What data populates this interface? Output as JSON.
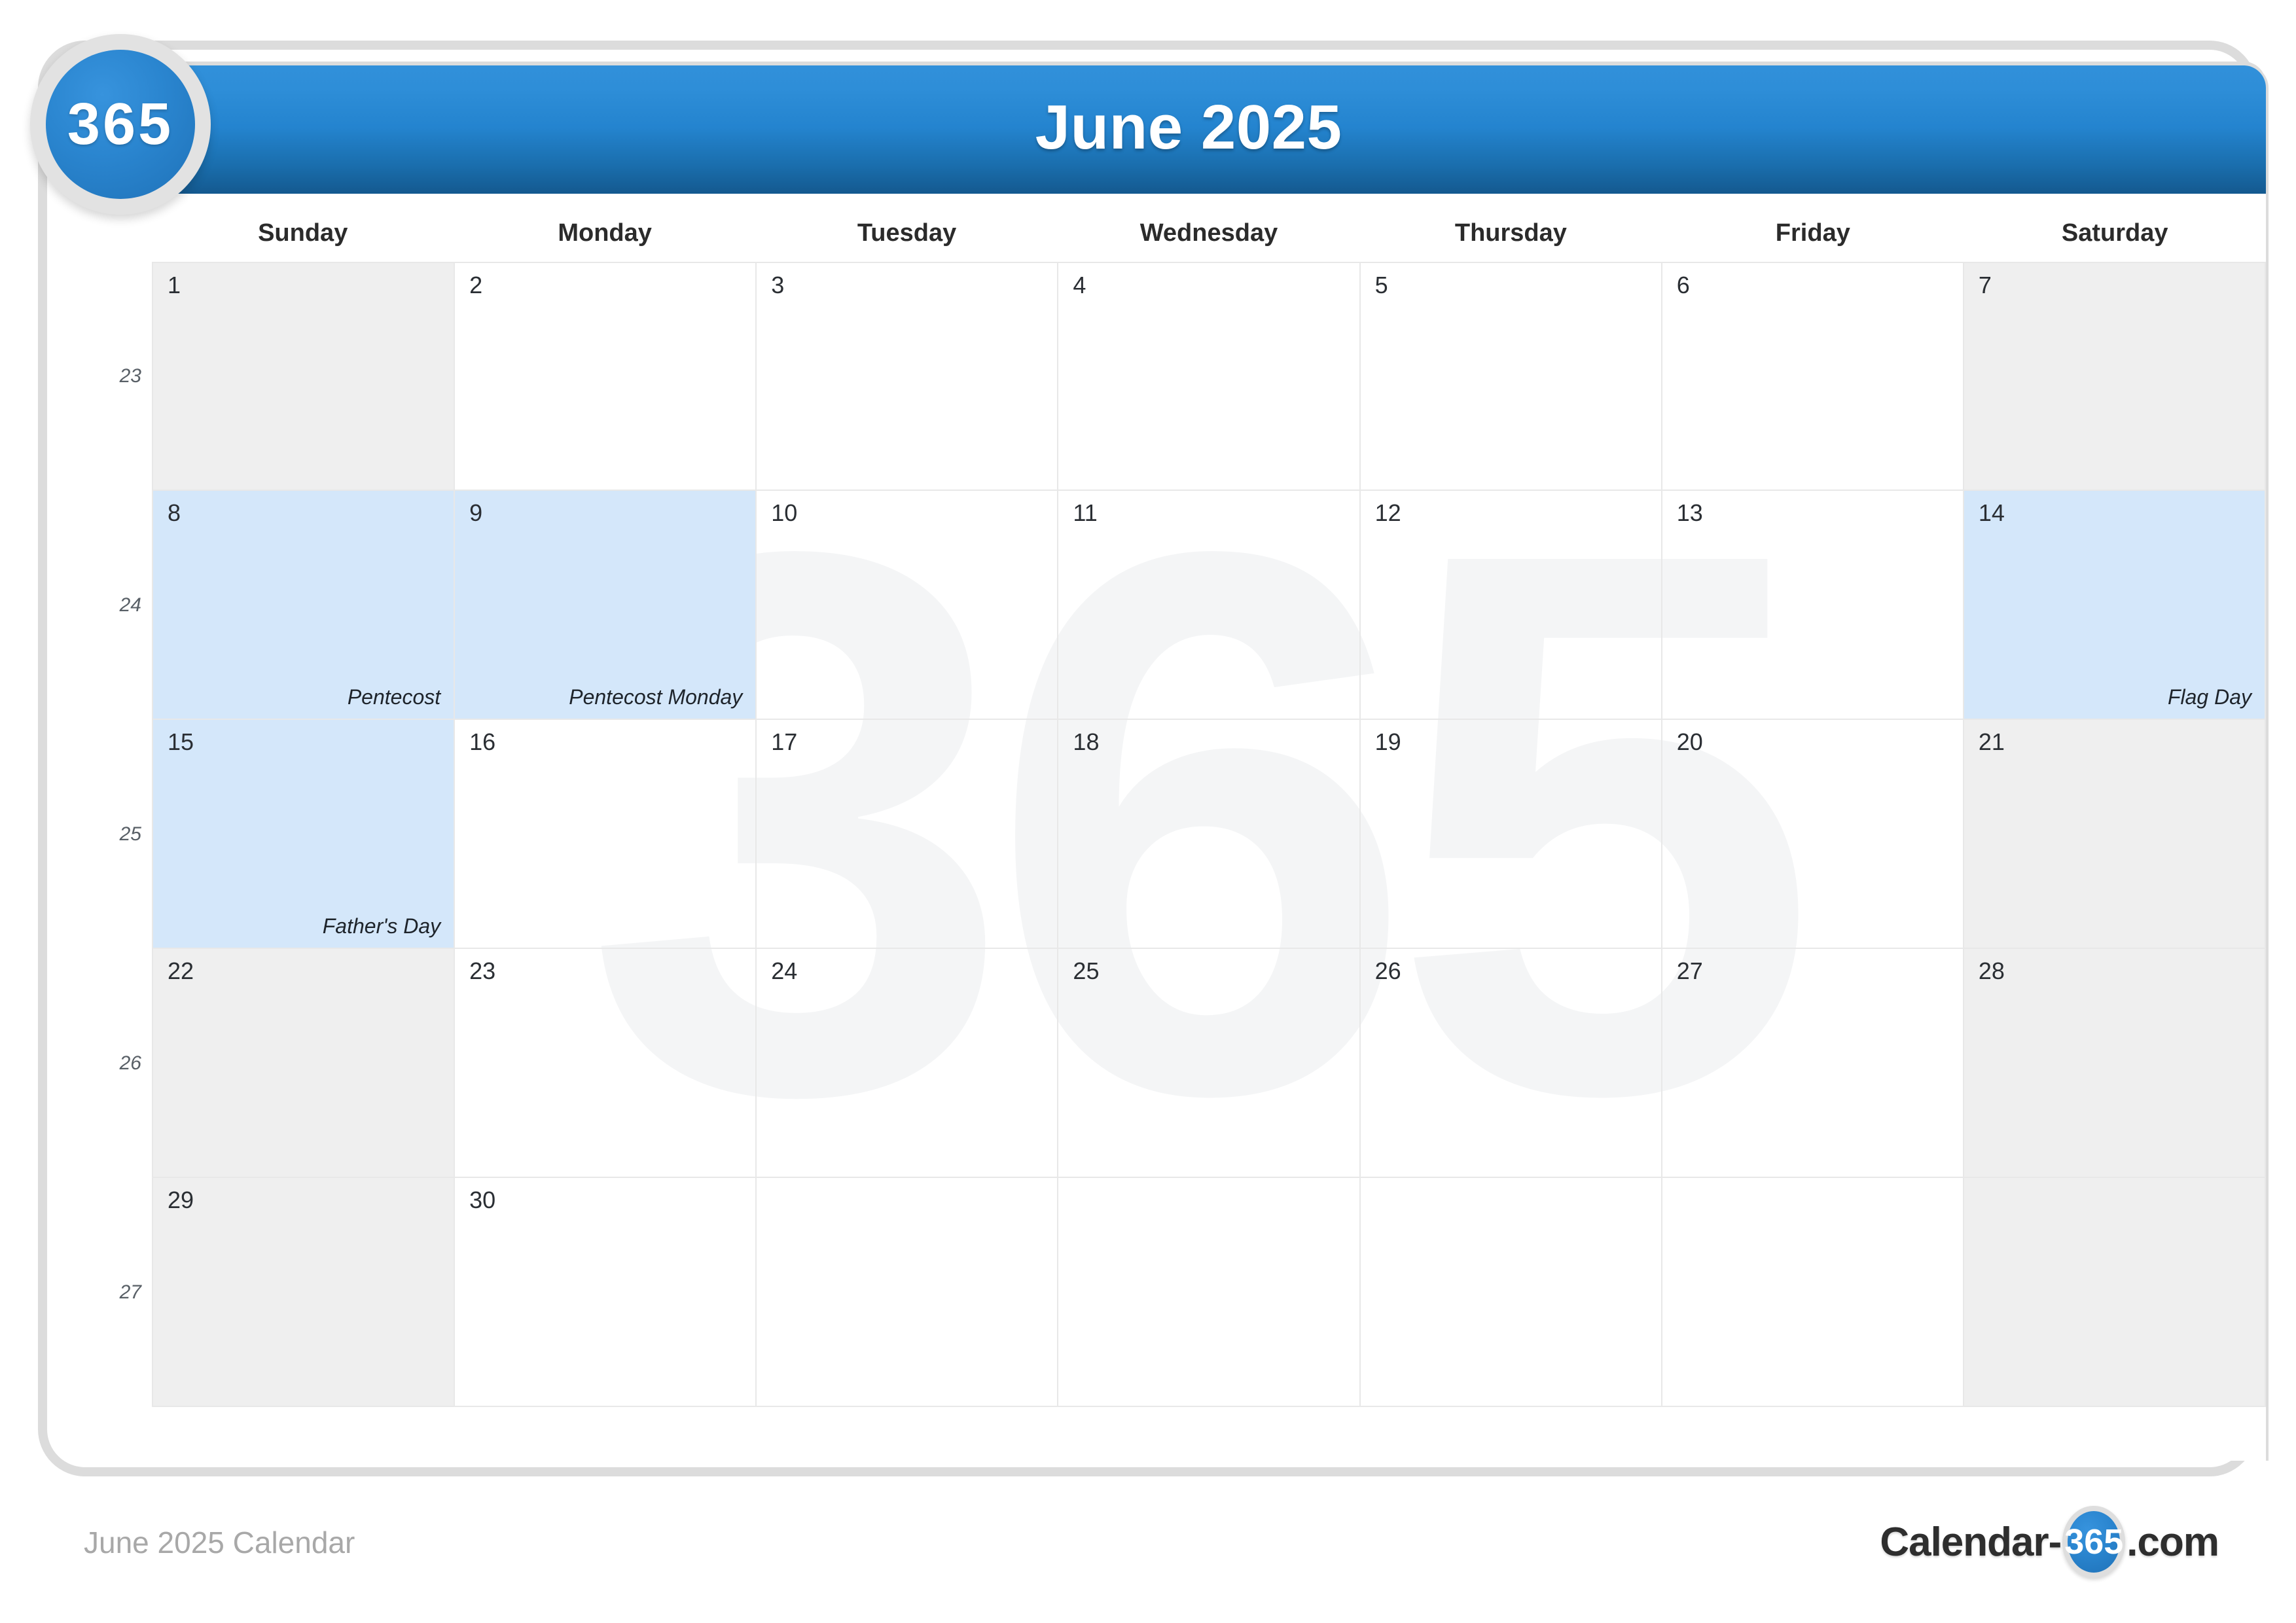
{
  "brand": {
    "badge_text": "365"
  },
  "header": {
    "title": "June 2025"
  },
  "weekdays": [
    "Sunday",
    "Monday",
    "Tuesday",
    "Wednesday",
    "Thursday",
    "Friday",
    "Saturday"
  ],
  "weeks": [
    {
      "week_number": "23",
      "days": [
        {
          "number": "1",
          "event": "",
          "weekend": true,
          "holiday": false,
          "blank": false
        },
        {
          "number": "2",
          "event": "",
          "weekend": false,
          "holiday": false,
          "blank": false
        },
        {
          "number": "3",
          "event": "",
          "weekend": false,
          "holiday": false,
          "blank": false
        },
        {
          "number": "4",
          "event": "",
          "weekend": false,
          "holiday": false,
          "blank": false
        },
        {
          "number": "5",
          "event": "",
          "weekend": false,
          "holiday": false,
          "blank": false
        },
        {
          "number": "6",
          "event": "",
          "weekend": false,
          "holiday": false,
          "blank": false
        },
        {
          "number": "7",
          "event": "",
          "weekend": true,
          "holiday": false,
          "blank": false
        }
      ]
    },
    {
      "week_number": "24",
      "days": [
        {
          "number": "8",
          "event": "Pentecost",
          "weekend": true,
          "holiday": true,
          "blank": false
        },
        {
          "number": "9",
          "event": "Pentecost Monday",
          "weekend": false,
          "holiday": true,
          "blank": false
        },
        {
          "number": "10",
          "event": "",
          "weekend": false,
          "holiday": false,
          "blank": false
        },
        {
          "number": "11",
          "event": "",
          "weekend": false,
          "holiday": false,
          "blank": false
        },
        {
          "number": "12",
          "event": "",
          "weekend": false,
          "holiday": false,
          "blank": false
        },
        {
          "number": "13",
          "event": "",
          "weekend": false,
          "holiday": false,
          "blank": false
        },
        {
          "number": "14",
          "event": "Flag Day",
          "weekend": true,
          "holiday": true,
          "blank": false
        }
      ]
    },
    {
      "week_number": "25",
      "days": [
        {
          "number": "15",
          "event": "Father's Day",
          "weekend": true,
          "holiday": true,
          "blank": false
        },
        {
          "number": "16",
          "event": "",
          "weekend": false,
          "holiday": false,
          "blank": false
        },
        {
          "number": "17",
          "event": "",
          "weekend": false,
          "holiday": false,
          "blank": false
        },
        {
          "number": "18",
          "event": "",
          "weekend": false,
          "holiday": false,
          "blank": false
        },
        {
          "number": "19",
          "event": "",
          "weekend": false,
          "holiday": false,
          "blank": false
        },
        {
          "number": "20",
          "event": "",
          "weekend": false,
          "holiday": false,
          "blank": false
        },
        {
          "number": "21",
          "event": "",
          "weekend": true,
          "holiday": false,
          "blank": false
        }
      ]
    },
    {
      "week_number": "26",
      "days": [
        {
          "number": "22",
          "event": "",
          "weekend": true,
          "holiday": false,
          "blank": false
        },
        {
          "number": "23",
          "event": "",
          "weekend": false,
          "holiday": false,
          "blank": false
        },
        {
          "number": "24",
          "event": "",
          "weekend": false,
          "holiday": false,
          "blank": false
        },
        {
          "number": "25",
          "event": "",
          "weekend": false,
          "holiday": false,
          "blank": false
        },
        {
          "number": "26",
          "event": "",
          "weekend": false,
          "holiday": false,
          "blank": false
        },
        {
          "number": "27",
          "event": "",
          "weekend": false,
          "holiday": false,
          "blank": false
        },
        {
          "number": "28",
          "event": "",
          "weekend": true,
          "holiday": false,
          "blank": false
        }
      ]
    },
    {
      "week_number": "27",
      "days": [
        {
          "number": "29",
          "event": "",
          "weekend": true,
          "holiday": false,
          "blank": false
        },
        {
          "number": "30",
          "event": "",
          "weekend": false,
          "holiday": false,
          "blank": false
        },
        {
          "number": "",
          "event": "",
          "weekend": false,
          "holiday": false,
          "blank": true
        },
        {
          "number": "",
          "event": "",
          "weekend": false,
          "holiday": false,
          "blank": true
        },
        {
          "number": "",
          "event": "",
          "weekend": false,
          "holiday": false,
          "blank": true
        },
        {
          "number": "",
          "event": "",
          "weekend": false,
          "holiday": false,
          "blank": true
        },
        {
          "number": "",
          "event": "",
          "weekend": true,
          "holiday": false,
          "blank": true
        }
      ]
    }
  ],
  "watermark": {
    "text": "365"
  },
  "footer": {
    "caption": "June 2025 Calendar",
    "logo_prefix": "Calendar-",
    "logo_badge": "365",
    "logo_suffix": ".com"
  },
  "colors": {
    "header_blue_top": "#3190da",
    "header_blue_bottom": "#14598f",
    "holiday_blue": "#d4e7fa",
    "weekend_gray": "#efefef",
    "frame_gray": "#dcdcdc",
    "grid_line": "#e8e8e8"
  }
}
